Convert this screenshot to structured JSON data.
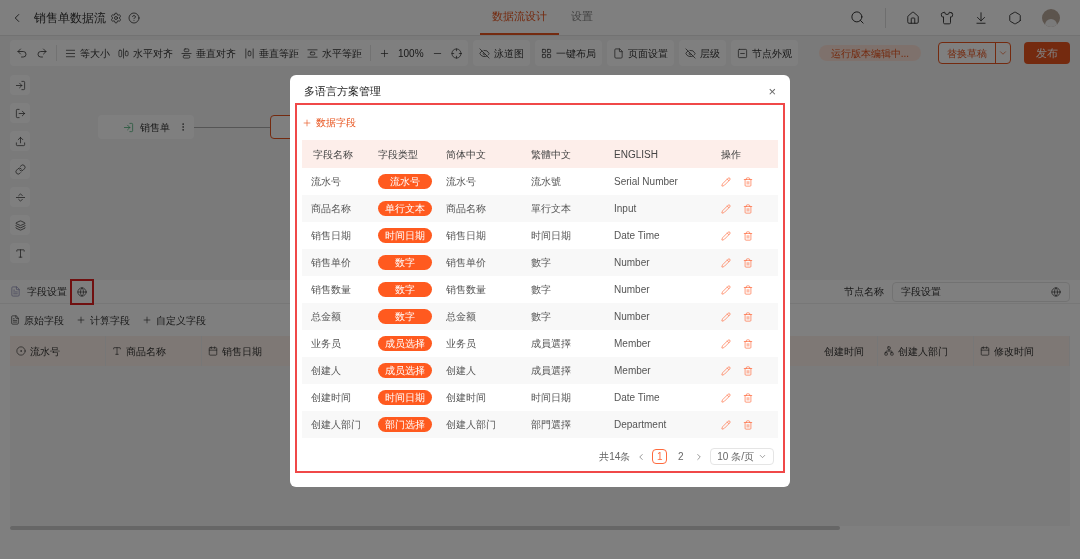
{
  "header": {
    "title": "销售单数据流",
    "tabs": [
      {
        "label": "数据流设计",
        "selected": true
      },
      {
        "label": "设置",
        "selected": false
      }
    ]
  },
  "toolbar": {
    "align_tools": [
      "等大小",
      "水平对齐",
      "垂直对齐",
      "垂直等距",
      "水平等距"
    ],
    "zoom": "100%",
    "view_buttons": [
      "泳道图",
      "一键布局",
      "页面设置",
      "层级",
      "节点外观"
    ],
    "status": "运行版本编辑中...",
    "draft_button": "替换草稿",
    "publish_button": "发布"
  },
  "canvas": {
    "node": "销售单"
  },
  "field_panel": {
    "title": "字段设置",
    "node_name_label": "节点名称",
    "node_name_value": "字段设置",
    "actions": [
      "原始字段",
      "计算字段",
      "自定义字段"
    ],
    "columns_left": [
      "流水号",
      "商品名称",
      "销售日期"
    ],
    "columns_right": [
      "创建时间",
      "创建人部门",
      "修改时间"
    ]
  },
  "dialog": {
    "title": "多语言方案管理",
    "close": "×",
    "add_button": "数据字段",
    "columns": [
      "字段名称",
      "字段类型",
      "简体中文",
      "繁體中文",
      "ENGLISH",
      "操作"
    ],
    "rows": [
      {
        "name": "流水号",
        "type": "流水号",
        "simplified": "流水号",
        "traditional": "流水號",
        "english": "Serial Number"
      },
      {
        "name": "商品名称",
        "type": "单行文本",
        "simplified": "商品名称",
        "traditional": "單行文本",
        "english": "Input"
      },
      {
        "name": "销售日期",
        "type": "时间日期",
        "simplified": "销售日期",
        "traditional": "时间日期",
        "english": "Date Time"
      },
      {
        "name": "销售单价",
        "type": "数字",
        "simplified": "销售单价",
        "traditional": "數字",
        "english": "Number"
      },
      {
        "name": "销售数量",
        "type": "数字",
        "simplified": "销售数量",
        "traditional": "數字",
        "english": "Number"
      },
      {
        "name": "总金额",
        "type": "数字",
        "simplified": "总金额",
        "traditional": "數字",
        "english": "Number"
      },
      {
        "name": "业务员",
        "type": "成员选择",
        "simplified": "业务员",
        "traditional": "成員選擇",
        "english": "Member"
      },
      {
        "name": "创建人",
        "type": "成员选择",
        "simplified": "创建人",
        "traditional": "成員選擇",
        "english": "Member"
      },
      {
        "name": "创建时间",
        "type": "时间日期",
        "simplified": "创建时间",
        "traditional": "时间日期",
        "english": "Date Time"
      },
      {
        "name": "创建人部门",
        "type": "部门选择",
        "simplified": "创建人部门",
        "traditional": "部門選擇",
        "english": "Department"
      }
    ],
    "pagination": {
      "total": "共14条",
      "pages": [
        {
          "label": "1",
          "selected": true
        },
        {
          "label": "2",
          "selected": false
        }
      ],
      "page_size": "10 条/页"
    }
  }
}
